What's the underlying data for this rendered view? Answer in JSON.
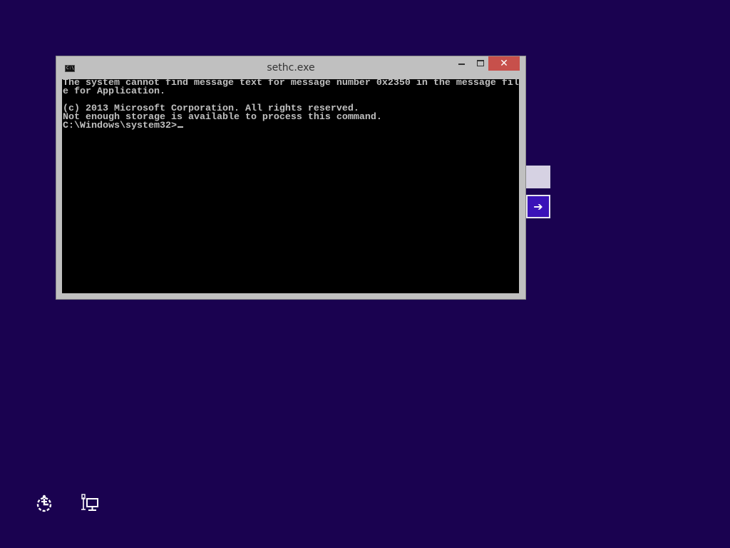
{
  "window": {
    "title": "sethc.exe",
    "app_icon_glyph": "C:\\",
    "close_glyph": "✕"
  },
  "console": {
    "lines": [
      "The system cannot find message text for message number 0x2350 in the message fil",
      "e for Application.",
      "",
      "(c) 2013 Microsoft Corporation. All rights reserved.",
      "Not enough storage is available to process this command.",
      "C:\\Windows\\system32>"
    ]
  },
  "sign_in": {
    "submit_glyph": "➔"
  },
  "icons": {
    "ease_of_access": "ease-of-access-icon",
    "network": "network-icon"
  },
  "colors": {
    "background": "#1a0250",
    "close_button": "#c7504b",
    "submit_button": "#3a12b8"
  }
}
